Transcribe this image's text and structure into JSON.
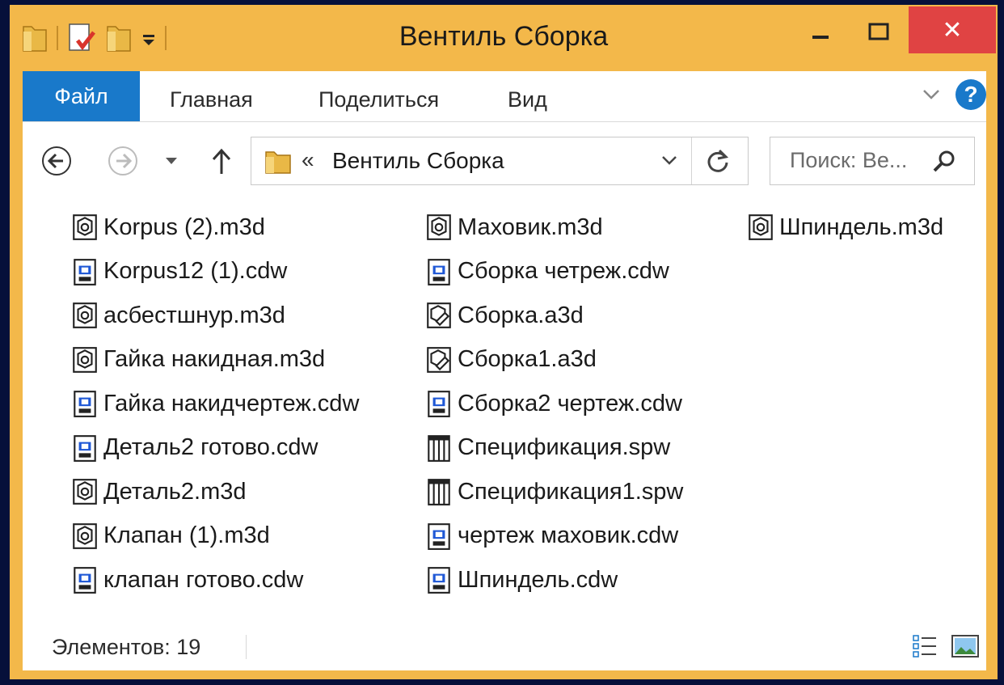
{
  "window": {
    "title": "Вентиль Сборка",
    "close_glyph": "✕"
  },
  "ribbon": {
    "tabs": [
      "Файл",
      "Главная",
      "Поделиться",
      "Вид"
    ],
    "help_glyph": "?"
  },
  "navigation": {
    "crumb_glyph": "«",
    "address_path": "Вентиль Сборка",
    "search_placeholder": "Поиск: Ве..."
  },
  "files": [
    {
      "name": "Korpus (2).m3d",
      "icon": "kompas-part-icon"
    },
    {
      "name": "Korpus12 (1).cdw",
      "icon": "kompas-drawing-icon"
    },
    {
      "name": "асбестшнур.m3d",
      "icon": "kompas-part-icon"
    },
    {
      "name": "Гайка накидная.m3d",
      "icon": "kompas-part-icon"
    },
    {
      "name": "Гайка накидчертеж.cdw",
      "icon": "kompas-drawing-icon"
    },
    {
      "name": "Деталь2 готово.cdw",
      "icon": "kompas-drawing-icon"
    },
    {
      "name": "Деталь2.m3d",
      "icon": "kompas-part-icon"
    },
    {
      "name": "Клапан (1).m3d",
      "icon": "kompas-part-icon"
    },
    {
      "name": "клапан готово.cdw",
      "icon": "kompas-drawing-icon"
    },
    {
      "name": "Маховик.m3d",
      "icon": "kompas-part-icon"
    },
    {
      "name": "Сборка четреж.cdw",
      "icon": "kompas-drawing-icon"
    },
    {
      "name": "Сборка.a3d",
      "icon": "kompas-assembly-icon"
    },
    {
      "name": "Сборка1.a3d",
      "icon": "kompas-assembly-icon"
    },
    {
      "name": "Сборка2 чертеж.cdw",
      "icon": "kompas-drawing-icon"
    },
    {
      "name": "Спецификация.spw",
      "icon": "kompas-spec-icon"
    },
    {
      "name": "Спецификация1.spw",
      "icon": "kompas-spec-icon"
    },
    {
      "name": "чертеж маховик.cdw",
      "icon": "kompas-drawing-icon"
    },
    {
      "name": "Шпиндель.cdw",
      "icon": "kompas-drawing-icon"
    },
    {
      "name": "Шпиндель.m3d",
      "icon": "kompas-part-icon"
    }
  ],
  "status": {
    "item_count": "Элементов: 19"
  },
  "colors": {
    "frame": "#f3b84a",
    "file_tab": "#1979ca",
    "close_button": "#e04343",
    "desktop": "#06103a"
  }
}
